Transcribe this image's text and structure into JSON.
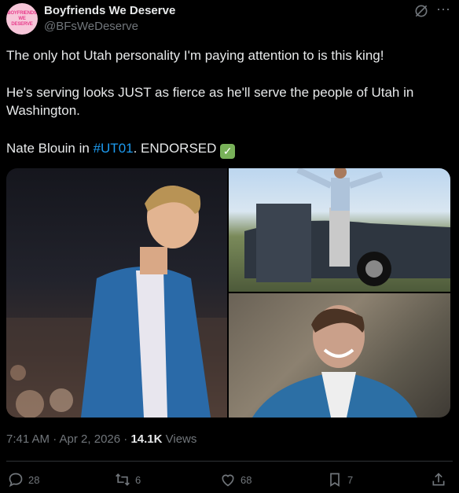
{
  "author": {
    "name": "Boyfriends We Deserve",
    "handle": "@BFsWeDeserve",
    "avatar_lines": [
      "BOYFRIENDS",
      "WE",
      "DESERVE"
    ]
  },
  "tweet": {
    "line1": "The only hot Utah personality I'm paying attention to is this king!",
    "line2": "He's serving looks JUST as fierce as he'll serve the people of Utah in Washington.",
    "line3_pre": "Nate Blouin in ",
    "hashtag": "#UT01",
    "line3_post": ". ENDORSED",
    "emoji": "✓"
  },
  "meta": {
    "time": "7:41 AM · Apr 2, 2026 · ",
    "views_count": "14.1K",
    "views_label": " Views"
  },
  "actions": {
    "replies": "28",
    "reposts": "6",
    "likes": "68",
    "bookmarks": "7"
  },
  "colors": {
    "background": "#000000",
    "text": "#e7e9ea",
    "secondary": "#71767b",
    "link": "#1d9bf0"
  }
}
